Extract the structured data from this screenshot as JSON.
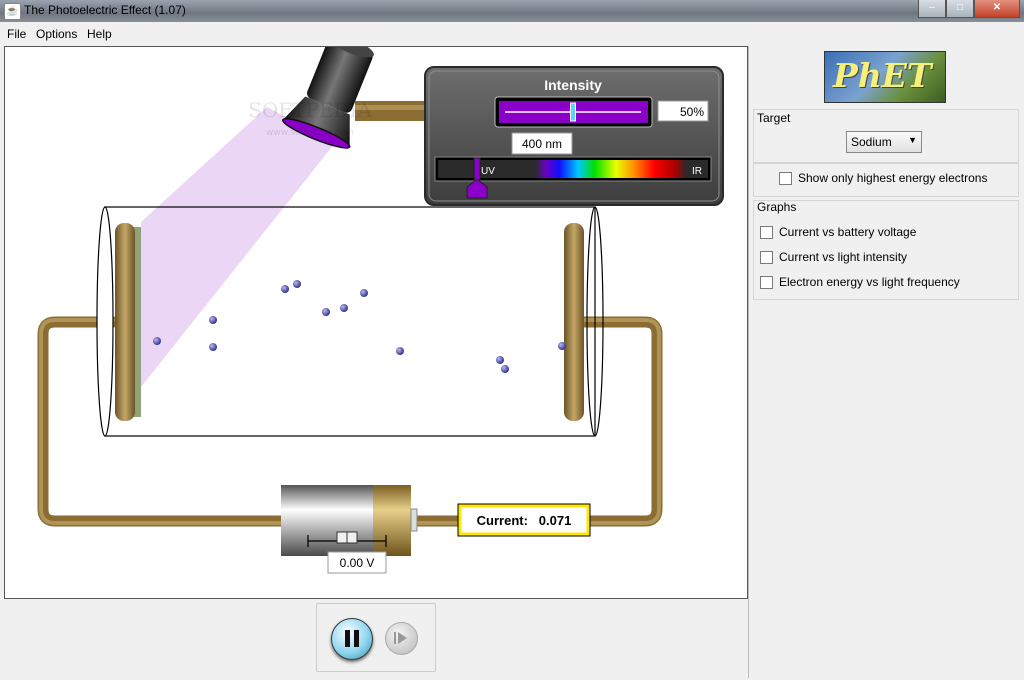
{
  "window": {
    "title": "The Photoelectric Effect (1.07)",
    "app_icon": "java-cup-icon",
    "controls": {
      "minimize": "–",
      "maximize": "□",
      "close": "✕"
    }
  },
  "menubar": {
    "items": [
      "File",
      "Options",
      "Help"
    ]
  },
  "simulation": {
    "watermark": "SOFTPEDIA",
    "watermark_url": "www.softpedia.com",
    "light_color": "#8a00c8",
    "intensity_panel": {
      "title": "Intensity",
      "intensity_value": "50%",
      "intensity_fraction": 0.5,
      "wavelength_value": "400 nm",
      "wavelength_fraction": 0.145,
      "spectrum_left_label": "UV",
      "spectrum_right_label": "IR"
    },
    "current_readout": "Current:   0.071",
    "battery_voltage": "0.00 V",
    "battery_slider_fraction": 0.5
  },
  "control_panel": {
    "logo_text": "PhET",
    "target": {
      "title": "Target",
      "selected": "Sodium"
    },
    "highest_energy_label": "Show only highest energy electrons",
    "graphs": {
      "title": "Graphs",
      "options": [
        "Current vs battery voltage",
        "Current vs light intensity",
        "Electron energy vs light frequency"
      ]
    }
  },
  "playback": {
    "pause_label": "pause",
    "step_label": "step"
  }
}
